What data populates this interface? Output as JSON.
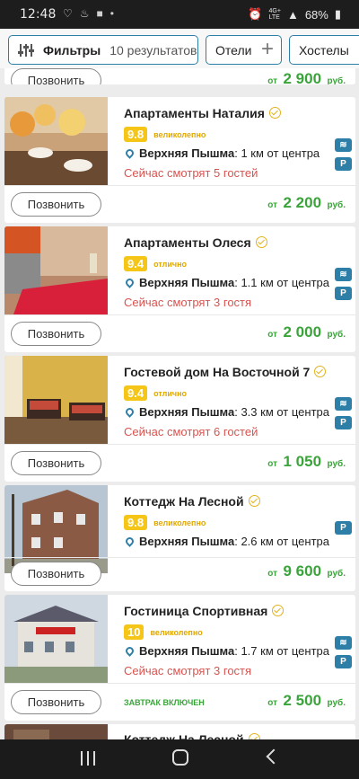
{
  "status": {
    "time": "12:48",
    "battery": "68%",
    "network": "4G+",
    "network_sub": "LTE"
  },
  "filters": {
    "label": "Фильтры",
    "count": "10 результатов",
    "hotels": "Отели",
    "hostels": "Хостелы"
  },
  "colors": {
    "accent": "#2d7fa8",
    "price": "#3aa43a",
    "rating": "#f5c518",
    "viewing": "#d9534f"
  },
  "listings": [
    {
      "call_label": "Позвонить",
      "price_from": "от",
      "price": "2 900",
      "currency": "руб."
    },
    {
      "title": "Апартаменты Наталия",
      "score": "9.8",
      "rating_label": "великолепно",
      "city": "Верхняя Пышма",
      "distance": ": 1 км от центра",
      "viewing": "Сейчас смотрят 5 гостей",
      "amenities": [
        "wifi",
        "P"
      ],
      "call_label": "Позвонить",
      "price_from": "от",
      "price": "2 200",
      "currency": "руб."
    },
    {
      "title": "Апартаменты Олеся",
      "score": "9.4",
      "rating_label": "отлично",
      "city": "Верхняя Пышма",
      "distance": ": 1.1 км от центра",
      "viewing": "Сейчас смотрят 3 гостя",
      "amenities": [
        "wifi",
        "P"
      ],
      "call_label": "Позвонить",
      "price_from": "от",
      "price": "2 000",
      "currency": "руб."
    },
    {
      "title": "Гостевой дом На Восточной 7",
      "score": "9.4",
      "rating_label": "отлично",
      "city": "Верхняя Пышма",
      "distance": ": 3.3 км от центра",
      "viewing": "Сейчас смотрят 6 гостей",
      "amenities": [
        "wifi",
        "P"
      ],
      "call_label": "Позвонить",
      "price_from": "от",
      "price": "1 050",
      "currency": "руб."
    },
    {
      "title": "Коттедж На Лесной",
      "score": "9.8",
      "rating_label": "великолепно",
      "city": "Верхняя Пышма",
      "distance": ": 2.6 км от центра",
      "amenities": [
        "P"
      ],
      "call_label": "Позвонить",
      "price_from": "от",
      "price": "9 600",
      "currency": "руб."
    },
    {
      "title": "Гостиница Спортивная",
      "score": "10",
      "rating_label": "великолепно",
      "city": "Верхняя Пышма",
      "distance": ": 1.7 км от центра",
      "viewing": "Сейчас смотрят 3 гостя",
      "amenities": [
        "wifi",
        "P"
      ],
      "call_label": "Позвонить",
      "breakfast": "завтрак включен",
      "price_from": "от",
      "price": "2 500",
      "currency": "руб."
    },
    {
      "title": "Коттедж На Лесной"
    }
  ]
}
